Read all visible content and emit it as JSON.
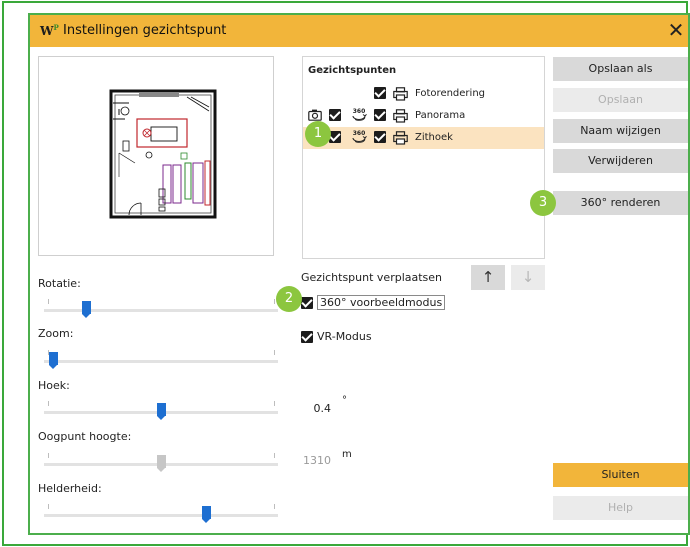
{
  "window": {
    "logo_text": "W",
    "logo_sup": "P",
    "title": "Instellingen gezichtspunt",
    "close_glyph": "✕"
  },
  "viewpoints": {
    "header": "Gezichtspunten",
    "items": [
      {
        "label": "Fotorendering",
        "camera": false,
        "pano360": false,
        "visible": true,
        "print": true,
        "selected": false
      },
      {
        "label": "Panorama",
        "camera": true,
        "pano360": true,
        "visible": true,
        "print": true,
        "selected": false
      },
      {
        "label": "Zithoek",
        "camera": false,
        "pano360": true,
        "visible": true,
        "print": true,
        "selected": true
      }
    ],
    "icons": {
      "camera": "camera-icon",
      "pano": "360-icon",
      "print": "printer-icon"
    },
    "pano_text": "360"
  },
  "buttons": {
    "save_as": "Opslaan als",
    "save": "Opslaan",
    "rename": "Naam wijzigen",
    "delete": "Verwijderen",
    "render360": "360° renderen",
    "close": "Sluiten",
    "help": "Help"
  },
  "move": {
    "label": "Gezichtspunt verplaatsen",
    "up_glyph": "↑",
    "down_glyph": "↓"
  },
  "options": {
    "preview360": {
      "label": "360° voorbeeldmodus",
      "checked": true
    },
    "vr": {
      "label": "VR-Modus",
      "checked": true
    }
  },
  "sliders": {
    "rotation": {
      "label": "Rotatie:",
      "value_fraction": 0.17
    },
    "zoom": {
      "label": "Zoom:",
      "value_fraction": 0.02
    },
    "angle": {
      "label": "Hoek:",
      "value_fraction": 0.5,
      "value": "0.4",
      "unit": "°"
    },
    "eye_height": {
      "label": "Oogpunt hoogte:",
      "value_fraction": 0.5,
      "value": "1310",
      "unit": "m",
      "disabled": true
    },
    "brightness": {
      "label": "Helderheid:",
      "value_fraction": 0.7
    }
  },
  "callouts": [
    "1",
    "2",
    "3"
  ],
  "colors": {
    "accent": "#f2b53a",
    "selection": "#fbe3c0",
    "callout": "#8cc63f",
    "slider_thumb": "#1e6fd1",
    "frame": "#3aa83a"
  }
}
